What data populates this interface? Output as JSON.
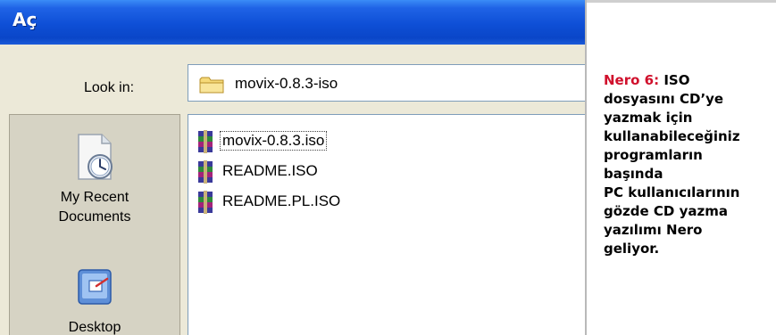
{
  "dialog": {
    "title": "Aç",
    "look_in": {
      "label": "Look in:",
      "value": "movix-0.8.3-iso",
      "icon": "folder-icon"
    },
    "places": [
      {
        "label_line1": "My Recent",
        "label_line2": "Documents",
        "icon": "recent-documents-icon"
      },
      {
        "label_line1": "Desktop",
        "label_line2": "",
        "icon": "desktop-icon"
      }
    ],
    "files": [
      {
        "name": "movix-0.8.3.iso",
        "icon": "archive-icon",
        "selected": true
      },
      {
        "name": "README.ISO",
        "icon": "archive-icon",
        "selected": false
      },
      {
        "name": "README.PL.ISO",
        "icon": "archive-icon",
        "selected": false
      }
    ]
  },
  "caption": {
    "lead": "Nero 6:",
    "lines": [
      "ISO",
      "dosyasını CD’ye",
      "yazmak için",
      "kullanabileceğiniz",
      "programların",
      "başında",
      "PC kullanıcılarının",
      "gözde CD yazma",
      "yazılımı Nero",
      "geliyor."
    ]
  },
  "colors": {
    "titlebar": "#0e4fd6",
    "caption_accent": "#d0102c",
    "dialog_background": "#ece9d8"
  }
}
